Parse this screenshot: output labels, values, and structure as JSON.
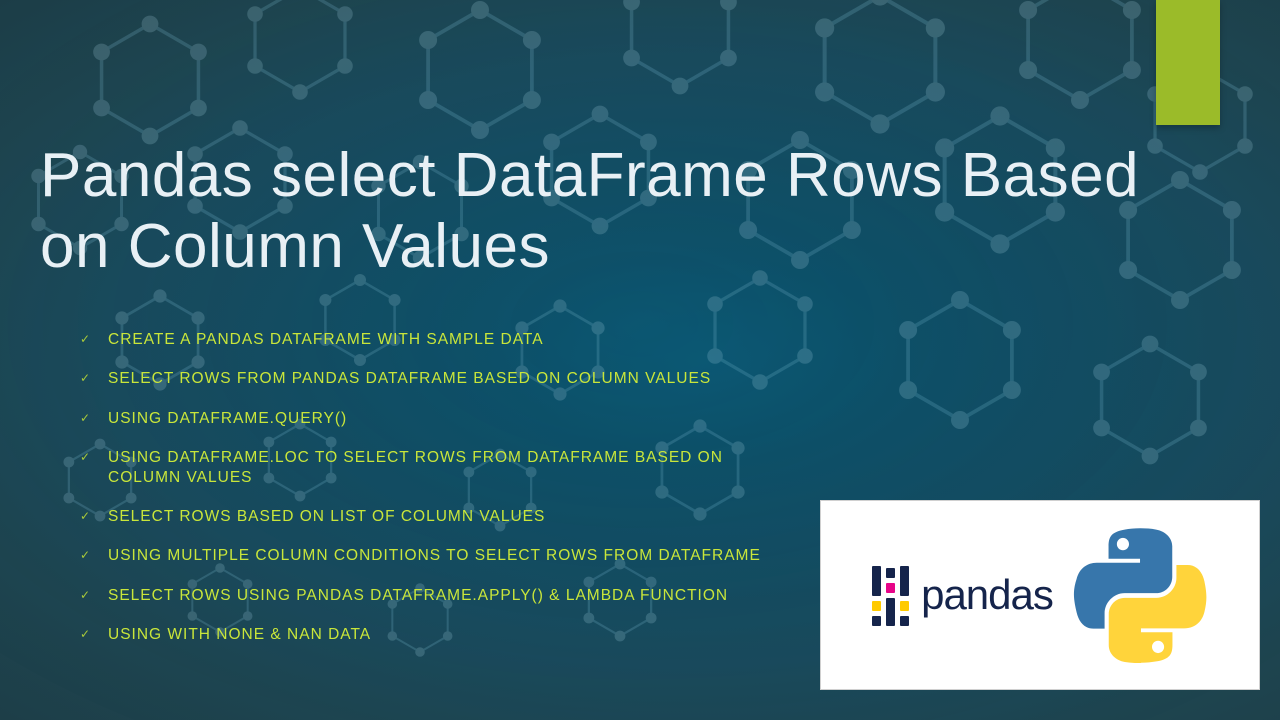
{
  "title": "Pandas select DataFrame Rows Based on Column Values",
  "bullets": [
    "CREATE A PANDAS DATAFRAME WITH SAMPLE DATA",
    "SELECT ROWS FROM PANDAS DATAFRAME BASED ON COLUMN VALUES",
    "USING DATAFRAME.QUERY()",
    "USING DATAFRAME.LOC TO SELECT ROWS FROM DATAFRAME BASED ON COLUMN VALUES",
    " SELECT ROWS BASED ON LIST OF COLUMN VALUES",
    "USING MULTIPLE COLUMN CONDITIONS TO SELECT ROWS FROM DATAFRAME",
    "SELECT ROWS USING PANDAS DATAFRAME.APPLY() & LAMBDA FUNCTION",
    "USING WITH NONE & NAN DATA"
  ],
  "logo": {
    "pandas_text": "pandas"
  },
  "colors": {
    "accent": "#9bbb29",
    "bullet_text": "#c9e63a",
    "title_text": "#e8f0f5"
  }
}
